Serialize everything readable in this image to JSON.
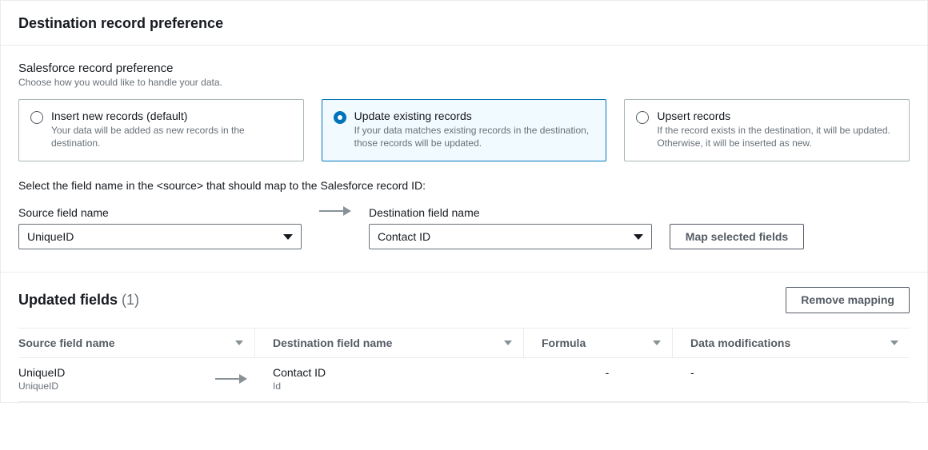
{
  "header": {
    "title": "Destination record preference"
  },
  "pref": {
    "subtitle": "Salesforce record preference",
    "hint": "Choose how you would like to handle your data.",
    "options": [
      {
        "title": "Insert new records (default)",
        "desc": "Your data will be added as new records in the destination."
      },
      {
        "title": "Update existing records",
        "desc": "If your data matches existing records in the destination, those records will be updated."
      },
      {
        "title": "Upsert records",
        "desc": "If the record exists in the destination, it will be updated. Otherwise, it will be inserted as new."
      }
    ],
    "selectedIndex": 1,
    "mapInstruction": "Select the field name in the <source> that should map to the Salesforce record ID:"
  },
  "fields": {
    "srcLabel": "Source field name",
    "srcValue": "UniqueID",
    "dstLabel": "Destination field name",
    "dstValue": "Contact ID",
    "mapButton": "Map selected fields"
  },
  "updated": {
    "title": "Updated fields",
    "count": "(1)",
    "removeButton": "Remove mapping",
    "columns": {
      "src": "Source field name",
      "dst": "Destination field name",
      "formula": "Formula",
      "mod": "Data modifications"
    },
    "rows": [
      {
        "srcMain": "UniqueID",
        "srcSub": "UniqueID",
        "dstMain": "Contact ID",
        "dstSub": "Id",
        "formula": "-",
        "mod": "-"
      }
    ]
  }
}
